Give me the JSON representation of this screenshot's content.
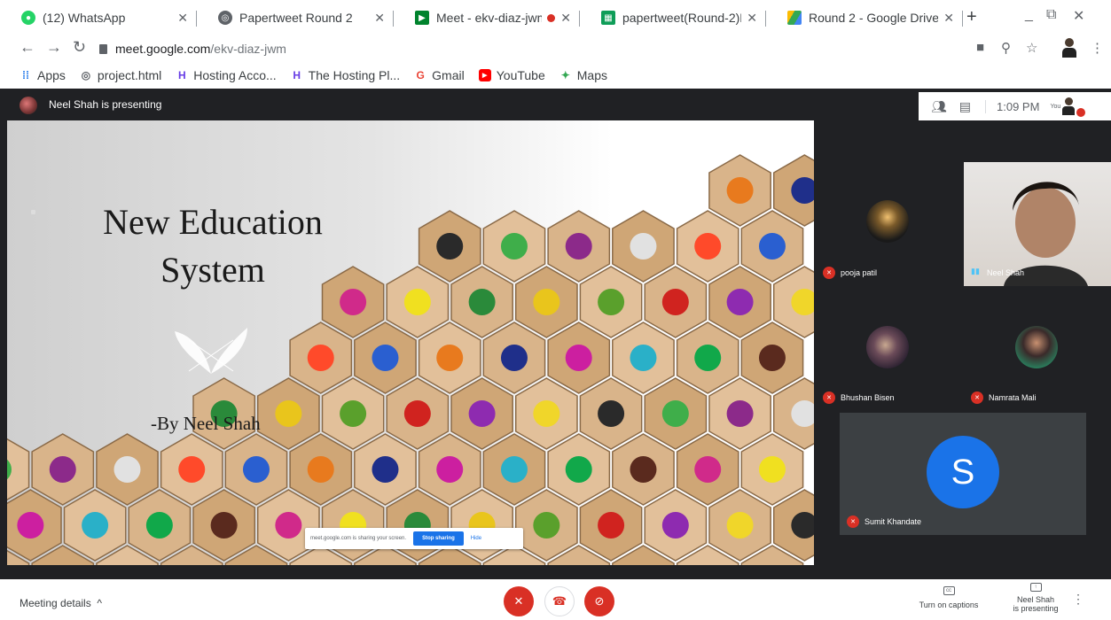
{
  "browser": {
    "tabs": [
      {
        "title": "(12) WhatsApp",
        "favicon": "whatsapp-icon",
        "color": "#25d366"
      },
      {
        "title": "Papertweet Round 2",
        "favicon": "globe-icon",
        "color": "#5f6368"
      },
      {
        "title": "Meet - ekv-diaz-jwm",
        "favicon": "meet-icon",
        "color": "#00832d"
      },
      {
        "title": "papertweet(Round-2)N",
        "favicon": "sheets-icon",
        "color": "#0f9d58"
      },
      {
        "title": "Round 2 - Google Drive",
        "favicon": "drive-icon",
        "color": "#fbbc04"
      }
    ],
    "url_host": "meet.google.com",
    "url_path": "/ekv-diaz-jwm",
    "bookmarks": [
      {
        "label": "Apps",
        "icon": "apps-grid-icon"
      },
      {
        "label": "project.html",
        "icon": "globe-icon"
      },
      {
        "label": "Hosting Acco...",
        "icon": "hostinger-icon"
      },
      {
        "label": "The Hosting Pl...",
        "icon": "hostinger-icon"
      },
      {
        "label": "Gmail",
        "icon": "google-icon"
      },
      {
        "label": "YouTube",
        "icon": "youtube-icon"
      },
      {
        "label": "Maps",
        "icon": "maps-icon"
      }
    ]
  },
  "meet": {
    "presenter_banner": "Neel Shah is presenting",
    "time": "1:09 PM",
    "you_label": "You",
    "slide": {
      "title_line1": "New Education",
      "title_line2": "System",
      "byline": "-By Neel Shah"
    },
    "share_notice": {
      "text": "meet.google.com is sharing your screen.",
      "stop_label": "Stop sharing",
      "hide_label": "Hide"
    },
    "participants": [
      {
        "name": "pooja patil",
        "muted": true
      },
      {
        "name": "Neel Shah",
        "muted": false,
        "speaking": true
      },
      {
        "name": "Bhushan Bisen",
        "muted": true
      },
      {
        "name": "Namrata Mali",
        "muted": true
      },
      {
        "name": "Sumit Khandate",
        "muted": true,
        "initial": "S"
      }
    ],
    "bottom": {
      "meeting_details": "Meeting details",
      "captions_label": "Turn on captions",
      "presenting_line1": "Neel Shah",
      "presenting_line2": "is presenting"
    }
  },
  "colors": {
    "meet_dark": "#202124",
    "tile": "#3c4043",
    "danger": "#d93025",
    "accent": "#1a73e8"
  }
}
